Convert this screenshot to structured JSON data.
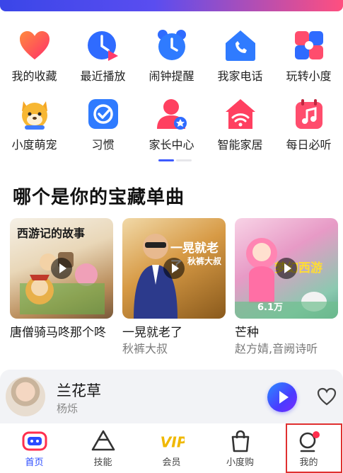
{
  "colors": {
    "accent": "#2a4bff",
    "highlight": "#e03030",
    "badge": "#ff2e4d"
  },
  "grid": {
    "items": [
      {
        "label": "我的收藏",
        "icon": "heart-icon"
      },
      {
        "label": "最近播放",
        "icon": "recent-play-icon"
      },
      {
        "label": "闹钟提醒",
        "icon": "alarm-clock-icon"
      },
      {
        "label": "我家电话",
        "icon": "home-phone-icon"
      },
      {
        "label": "玩转小度",
        "icon": "puzzle-icon"
      },
      {
        "label": "小度萌宠",
        "icon": "pet-icon"
      },
      {
        "label": "习惯",
        "icon": "habit-check-icon"
      },
      {
        "label": "家长中心",
        "icon": "parent-center-icon"
      },
      {
        "label": "智能家居",
        "icon": "smart-home-icon"
      },
      {
        "label": "每日必听",
        "icon": "daily-music-icon"
      }
    ]
  },
  "section": {
    "title": "哪个是你的宝藏单曲"
  },
  "cards": [
    {
      "title": "唐僧骑马咚那个咚",
      "subtitle": "",
      "thumb_text": "西游记的故事",
      "play_count": ""
    },
    {
      "title": "一晃就老了",
      "subtitle": "秋裤大叔",
      "thumb_text": "一晃就老了",
      "thumb_sub": "秋裤大叔",
      "play_count": ""
    },
    {
      "title": "芒种",
      "subtitle": "赵方婧,音阙诗听",
      "thumb_text": "梦幻西游",
      "play_count": "6.1万"
    }
  ],
  "player": {
    "title": "兰花草",
    "artist": "杨烁"
  },
  "tabbar": {
    "tabs": [
      {
        "label": "首页",
        "icon": "home-tab-icon",
        "active": true
      },
      {
        "label": "技能",
        "icon": "skills-tab-icon",
        "active": false
      },
      {
        "label": "会员",
        "icon": "vip-tab-icon",
        "active": false
      },
      {
        "label": "小度购",
        "icon": "shopping-bag-icon",
        "active": false
      },
      {
        "label": "我的",
        "icon": "profile-tab-icon",
        "active": false
      }
    ]
  }
}
